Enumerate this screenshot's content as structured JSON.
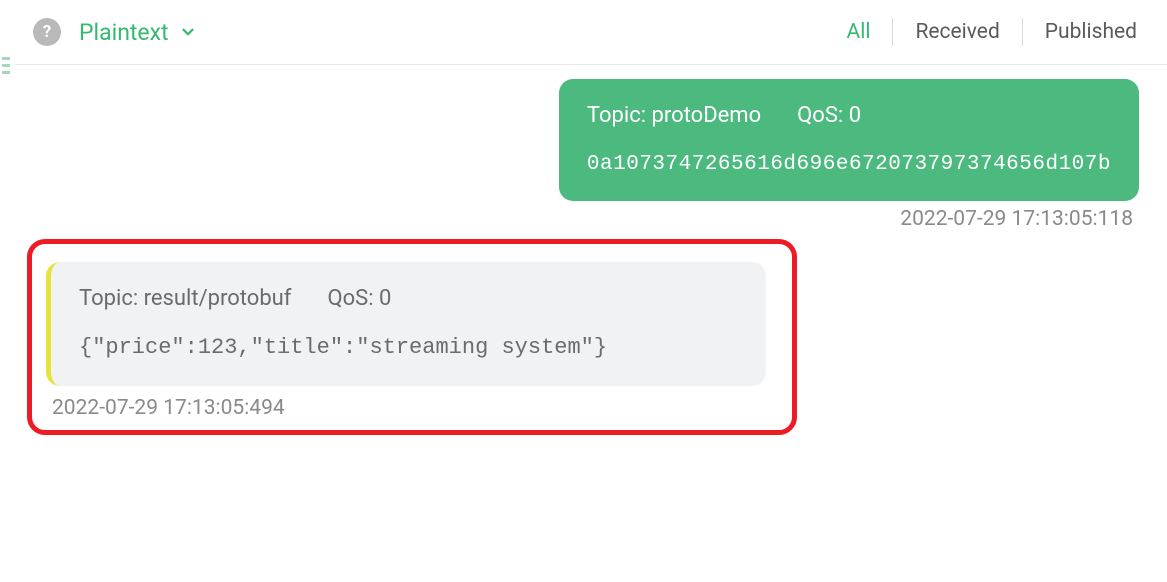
{
  "header": {
    "format_label": "Plaintext",
    "help_glyph": "?",
    "filters": [
      {
        "label": "All",
        "active": true
      },
      {
        "label": "Received",
        "active": false
      },
      {
        "label": "Published",
        "active": false
      }
    ]
  },
  "messages": [
    {
      "direction": "sent",
      "topic": "protoDemo",
      "qos": "0",
      "payload": "0a1073747265616d696e672073797374656d107b",
      "timestamp": "2022-07-29 17:13:05:118",
      "highlighted": false
    },
    {
      "direction": "recv",
      "topic": "result/protobuf",
      "qos": "0",
      "payload": "{\"price\":123,\"title\":\"streaming system\"}",
      "timestamp": "2022-07-29 17:13:05:494",
      "highlighted": true
    }
  ],
  "labels": {
    "topic_prefix": "Topic: ",
    "qos_prefix": "QoS: "
  },
  "colors": {
    "accent": "#35b96e",
    "sent_bubble": "#4cb97f",
    "recv_bubble": "#f1f2f3",
    "highlight_border": "#ed1c24",
    "recv_stripe": "#e6e33a"
  }
}
